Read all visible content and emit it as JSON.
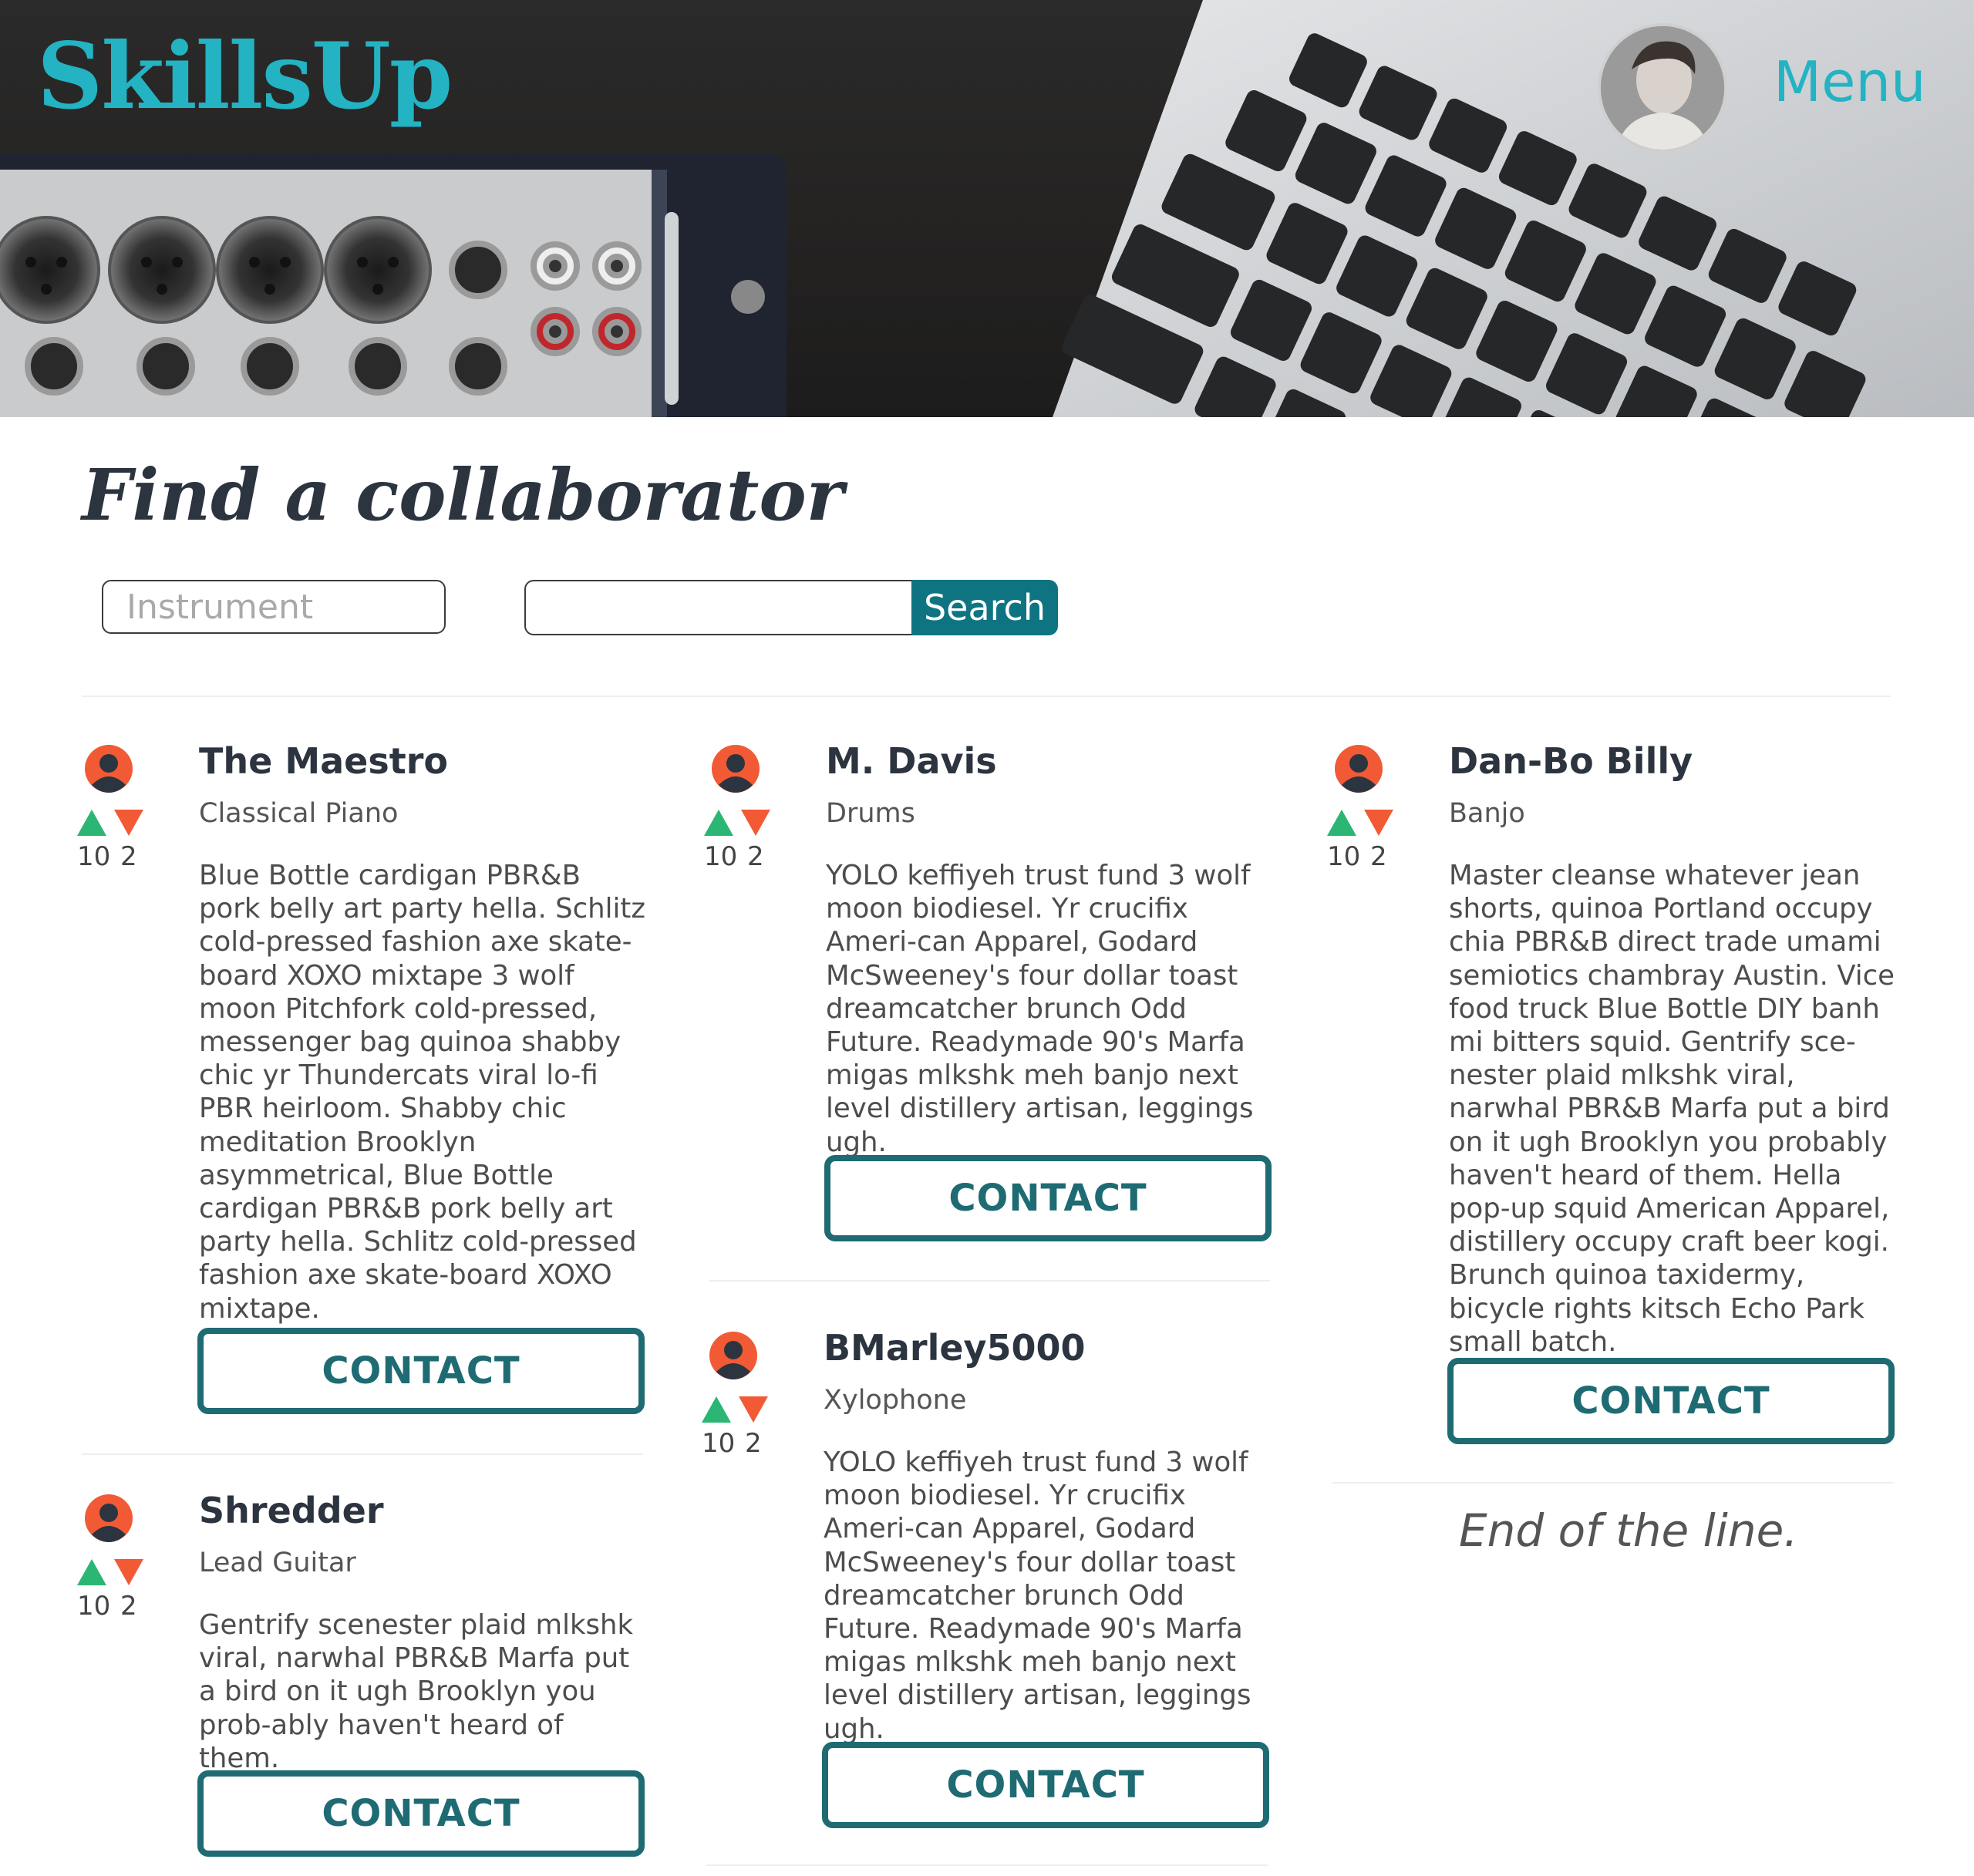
{
  "header": {
    "logo": "SkillsUp",
    "menu_label": "Menu"
  },
  "page": {
    "title": "Find a collaborator"
  },
  "search": {
    "instrument_placeholder": "Instrument",
    "query_value": "",
    "button_label": "Search"
  },
  "colors": {
    "brand_teal": "#23b3c3",
    "button_teal": "#0f7482",
    "contact_border": "#1e6b73",
    "upvote_green": "#2bb673",
    "downvote_red": "#f15a35",
    "avatar_orange": "#f15a35",
    "avatar_navy": "#2c3440"
  },
  "icons": {
    "upvote": "triangle-up-icon",
    "downvote": "triangle-down-icon",
    "user": "user-avatar-icon"
  },
  "collaborators": [
    {
      "name": "The Maestro",
      "instrument": "Classical Piano",
      "upvotes": "10",
      "downvotes": "2",
      "bio": "Blue Bottle cardigan PBR&B pork belly art party hella. Schlitz cold-pressed fashion axe skate-board XOXO mixtape 3 wolf moon Pitchfork cold-pressed, messenger bag quinoa shabby chic yr Thundercats viral lo-fi PBR heirloom. Shabby chic meditation Brooklyn asymmetrical, Blue Bottle cardigan PBR&B pork belly art party hella. Schlitz cold-pressed fashion axe skate-board XOXO mixtape.",
      "contact_label": "CONTACT"
    },
    {
      "name": "Shredder",
      "instrument": "Lead Guitar",
      "upvotes": "10",
      "downvotes": "2",
      "bio": "Gentrify scenester plaid mlkshk viral, narwhal PBR&B Marfa put a bird on it ugh Brooklyn you prob-ably haven't heard of them.",
      "contact_label": "CONTACT"
    },
    {
      "name": "M. Davis",
      "instrument": "Drums",
      "upvotes": "10",
      "downvotes": "2",
      "bio": "YOLO keffiyeh trust fund 3 wolf moon biodiesel. Yr crucifix Ameri-can Apparel, Godard McSweeney's four dollar toast dreamcatcher brunch Odd Future. Readymade 90's Marfa migas mlkshk meh banjo next level distillery artisan, leggings ugh.",
      "contact_label": "CONTACT"
    },
    {
      "name": "BMarley5000",
      "instrument": "Xylophone",
      "upvotes": "10",
      "downvotes": "2",
      "bio": "YOLO keffiyeh trust fund 3 wolf moon biodiesel. Yr crucifix Ameri-can Apparel, Godard McSweeney's four dollar toast dreamcatcher brunch Odd Future. Readymade 90's Marfa migas mlkshk meh banjo next level distillery artisan, leggings ugh.",
      "contact_label": "CONTACT"
    },
    {
      "name": "Dan-Bo Billy",
      "instrument": "Banjo",
      "upvotes": "10",
      "downvotes": "2",
      "bio": "Master cleanse whatever jean shorts, quinoa Portland occupy chia PBR&B direct trade umami semiotics chambray Austin. Vice food truck Blue Bottle DIY banh mi bitters squid. Gentrify sce-nester plaid mlkshk viral, narwhal PBR&B Marfa put a bird on it ugh Brooklyn you probably haven't heard of them. Hella pop-up squid American Apparel, distillery occupy craft beer kogi. Brunch quinoa taxidermy, bicycle rights kitsch Echo Park small batch.",
      "contact_label": "CONTACT"
    }
  ],
  "end_note": "End of the line."
}
